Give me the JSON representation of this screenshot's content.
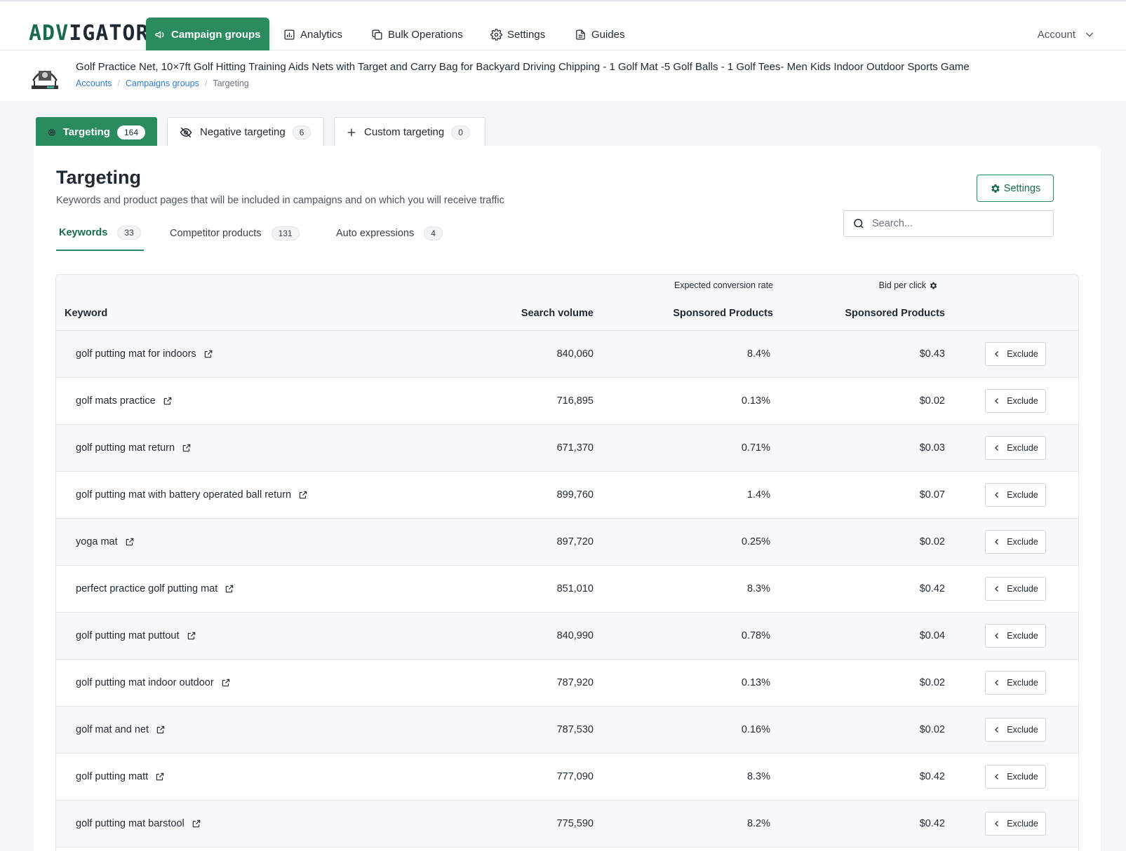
{
  "brand": {
    "part1": "ADV",
    "part2": "IGATOR"
  },
  "nav": [
    {
      "label": "Campaign groups",
      "icon": "megaphone-icon"
    },
    {
      "label": "Analytics",
      "icon": "bar-chart-icon"
    },
    {
      "label": "Bulk Operations",
      "icon": "copy-icon"
    },
    {
      "label": "Settings",
      "icon": "gear-icon"
    },
    {
      "label": "Guides",
      "icon": "document-icon"
    }
  ],
  "account": {
    "label": "Account"
  },
  "product": {
    "title": "Golf Practice Net, 10×7ft Golf Hitting Training Aids Nets with Target and Carry Bag for Backyard Driving Chipping - 1 Golf Mat -5 Golf Balls - 1 Golf Tees- Men Kids Indoor Outdoor Sports Game",
    "breadcrumb": [
      "Accounts",
      "Campaigns groups",
      "Targeting"
    ]
  },
  "outer_tabs": [
    {
      "label": "Targeting",
      "count": "164"
    },
    {
      "label": "Negative targeting",
      "count": "6"
    },
    {
      "label": "Custom targeting",
      "count": "0"
    }
  ],
  "card": {
    "title": "Targeting",
    "subtitle": "Keywords and product pages that will be included in campaigns and on which you will receive traffic",
    "settings_label": "Settings",
    "search_placeholder": "Search..."
  },
  "inner_tabs": [
    {
      "label": "Keywords",
      "count": "33"
    },
    {
      "label": "Competitor products",
      "count": "131"
    },
    {
      "label": "Auto expressions",
      "count": "4"
    }
  ],
  "table": {
    "super_headers": {
      "conversion": "Expected conversion rate",
      "bid": "Bid per click"
    },
    "headers": {
      "keyword": "Keyword",
      "volume": "Search volume",
      "conversion": "Sponsored Products",
      "bid": "Sponsored Products"
    },
    "exclude_label": "Exclude",
    "rows": [
      {
        "keyword": "golf putting mat for indoors",
        "volume": "840,060",
        "conversion": "8.4%",
        "bid": "$0.43"
      },
      {
        "keyword": "golf mats practice",
        "volume": "716,895",
        "conversion": "0.13%",
        "bid": "$0.02"
      },
      {
        "keyword": "golf putting mat return",
        "volume": "671,370",
        "conversion": "0.71%",
        "bid": "$0.03"
      },
      {
        "keyword": "golf putting mat with battery operated ball return",
        "volume": "899,760",
        "conversion": "1.4%",
        "bid": "$0.07"
      },
      {
        "keyword": "yoga mat",
        "volume": "897,720",
        "conversion": "0.25%",
        "bid": "$0.02"
      },
      {
        "keyword": "perfect practice golf putting mat",
        "volume": "851,010",
        "conversion": "8.3%",
        "bid": "$0.42"
      },
      {
        "keyword": "golf putting mat puttout",
        "volume": "840,990",
        "conversion": "0.78%",
        "bid": "$0.04"
      },
      {
        "keyword": "golf putting mat indoor outdoor",
        "volume": "787,920",
        "conversion": "0.13%",
        "bid": "$0.02"
      },
      {
        "keyword": "golf mat and net",
        "volume": "787,530",
        "conversion": "0.16%",
        "bid": "$0.02"
      },
      {
        "keyword": "golf putting matt",
        "volume": "777,090",
        "conversion": "8.3%",
        "bid": "$0.42"
      },
      {
        "keyword": "golf putting mat barstool",
        "volume": "775,590",
        "conversion": "8.2%",
        "bid": "$0.42"
      }
    ]
  }
}
